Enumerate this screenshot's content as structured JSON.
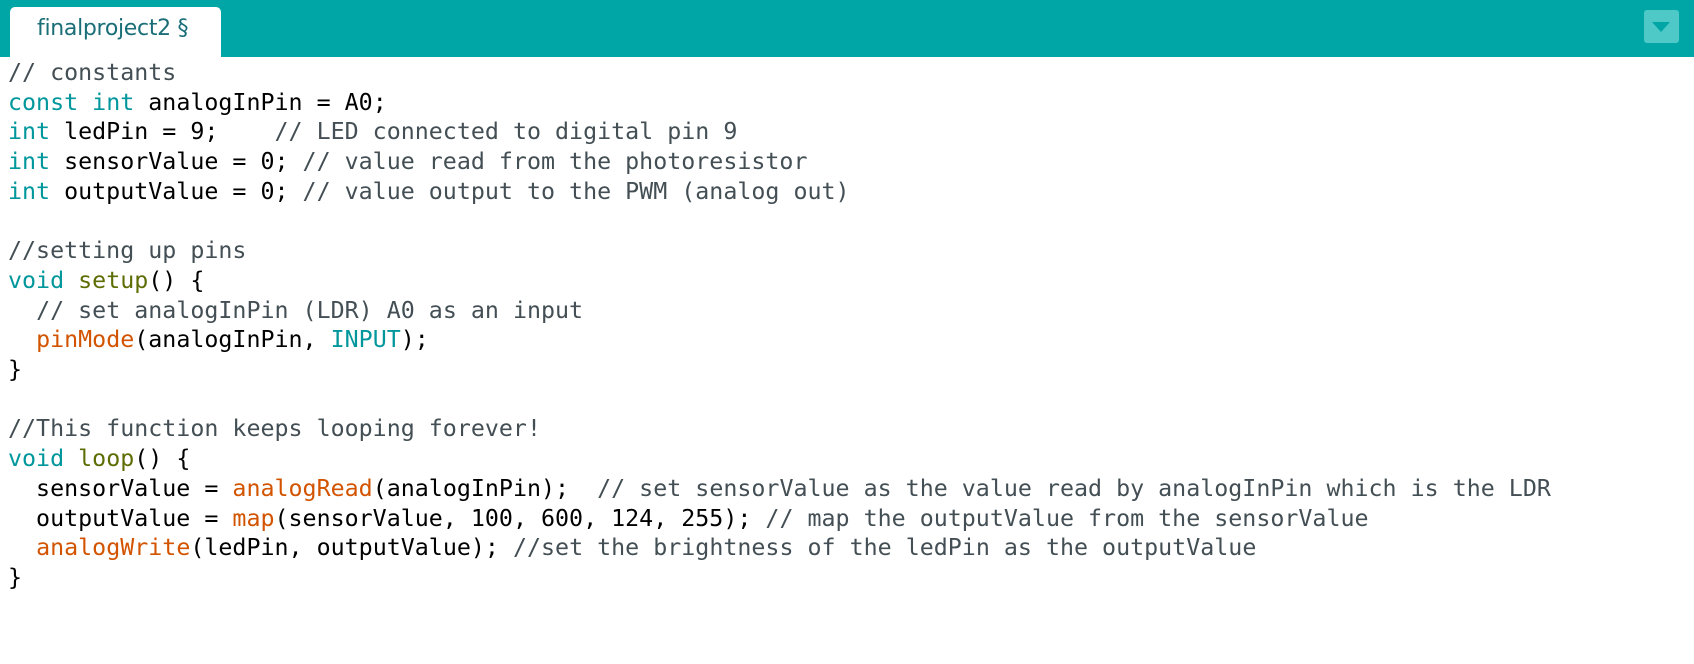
{
  "tab": {
    "label": "finalproject2 §"
  },
  "code_lines": [
    [
      {
        "t": "// constants",
        "c": "comment"
      }
    ],
    [
      {
        "t": "const",
        "c": "keyword"
      },
      {
        "t": " ",
        "c": "plain"
      },
      {
        "t": "int",
        "c": "keyword"
      },
      {
        "t": " analogInPin = A0;",
        "c": "plain"
      }
    ],
    [
      {
        "t": "int",
        "c": "keyword"
      },
      {
        "t": " ledPin = 9;    ",
        "c": "plain"
      },
      {
        "t": "// LED connected to digital pin 9",
        "c": "comment"
      }
    ],
    [
      {
        "t": "int",
        "c": "keyword"
      },
      {
        "t": " sensorValue = 0; ",
        "c": "plain"
      },
      {
        "t": "// value read from the photoresistor",
        "c": "comment"
      }
    ],
    [
      {
        "t": "int",
        "c": "keyword"
      },
      {
        "t": " outputValue = 0; ",
        "c": "plain"
      },
      {
        "t": "// value output to the PWM (analog out)",
        "c": "comment"
      }
    ],
    [],
    [
      {
        "t": "//setting up pins",
        "c": "comment"
      }
    ],
    [
      {
        "t": "void",
        "c": "keyword"
      },
      {
        "t": " ",
        "c": "plain"
      },
      {
        "t": "setup",
        "c": "func"
      },
      {
        "t": "() {",
        "c": "plain"
      }
    ],
    [
      {
        "t": "  ",
        "c": "plain"
      },
      {
        "t": "// set analogInPin (LDR) A0 as an input",
        "c": "comment"
      }
    ],
    [
      {
        "t": "  ",
        "c": "plain"
      },
      {
        "t": "pinMode",
        "c": "builtin"
      },
      {
        "t": "(analogInPin, ",
        "c": "plain"
      },
      {
        "t": "INPUT",
        "c": "const"
      },
      {
        "t": ");",
        "c": "plain"
      }
    ],
    [
      {
        "t": "}",
        "c": "plain"
      }
    ],
    [],
    [
      {
        "t": "//This function keeps looping forever!",
        "c": "comment"
      }
    ],
    [
      {
        "t": "void",
        "c": "keyword"
      },
      {
        "t": " ",
        "c": "plain"
      },
      {
        "t": "loop",
        "c": "func"
      },
      {
        "t": "() {",
        "c": "plain"
      }
    ],
    [
      {
        "t": "  sensorValue = ",
        "c": "plain"
      },
      {
        "t": "analogRead",
        "c": "builtin"
      },
      {
        "t": "(analogInPin);  ",
        "c": "plain"
      },
      {
        "t": "// set sensorValue as the value read by analogInPin which is the LDR",
        "c": "comment"
      }
    ],
    [
      {
        "t": "  outputValue = ",
        "c": "plain"
      },
      {
        "t": "map",
        "c": "builtin"
      },
      {
        "t": "(sensorValue, 100, 600, 124, 255); ",
        "c": "plain"
      },
      {
        "t": "// map the outputValue from the sensorValue",
        "c": "comment"
      }
    ],
    [
      {
        "t": "  ",
        "c": "plain"
      },
      {
        "t": "analogWrite",
        "c": "builtin"
      },
      {
        "t": "(ledPin, outputValue); ",
        "c": "plain"
      },
      {
        "t": "//set the brightness of the ledPin as the outputValue",
        "c": "comment"
      }
    ],
    [
      {
        "t": "}",
        "c": "plain"
      }
    ]
  ]
}
